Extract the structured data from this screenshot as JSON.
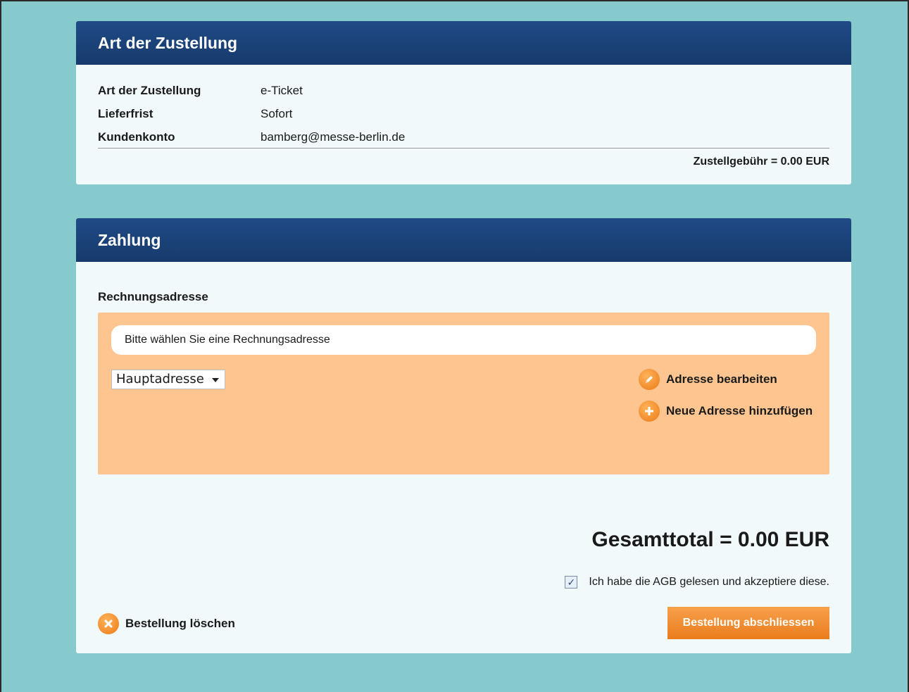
{
  "delivery": {
    "header": "Art der Zustellung",
    "rows": [
      {
        "label": "Art der Zustellung",
        "value": "e-Ticket"
      },
      {
        "label": "Lieferfrist",
        "value": "Sofort"
      },
      {
        "label": "Kundenkonto",
        "value": "bamberg@messe-berlin.de"
      }
    ],
    "fee": "Zustellgebühr = 0.00 EUR"
  },
  "payment": {
    "header": "Zahlung",
    "billing_label": "Rechnungsadresse",
    "address_prompt": "Bitte wählen Sie eine Rechnungsadresse",
    "address_select": "Hauptadresse",
    "edit_address": "Adresse bearbeiten",
    "add_address": "Neue Adresse hinzufügen",
    "total": "Gesamttotal = 0.00 EUR",
    "agb_text": "Ich habe die AGB gelesen und akzeptiere diese.",
    "agb_checked": true,
    "delete_order": "Bestellung löschen",
    "submit": "Bestellung abschliessen"
  },
  "colors": {
    "background": "#87cacd",
    "header": "#1f4b86",
    "accent": "#ec7a14",
    "address_box": "#fec591"
  }
}
